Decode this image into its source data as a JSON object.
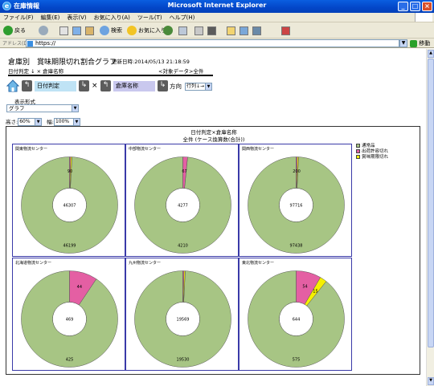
{
  "window": {
    "page_title": "在庫情報",
    "app_title": "Microsoft Internet Explorer",
    "min": "_",
    "max": "□",
    "close": "×"
  },
  "menu": [
    "ファイル(F)",
    "編集(E)",
    "表示(V)",
    "お気に入り(A)",
    "ツール(T)",
    "ヘルプ(H)"
  ],
  "toolbar": {
    "back": "戻る",
    "search": "検索",
    "favorites": "お気に入り"
  },
  "address": {
    "label": "アドレス(D)",
    "url": "https://",
    "go": "移動"
  },
  "report": {
    "title": "倉庫別　賞味期限切れ割合グラフ",
    "updated": "更新日時:2014/05/13 21:18:59",
    "condition": "日付判定 ↓ × 倉庫名称",
    "filter": "<対象データ>全件",
    "row_axis": "日付判定",
    "times": "×",
    "col_axis": "倉庫名称",
    "direction_label": "方向",
    "direction_value": "行列",
    "direction_arrow": "↓→",
    "display_label": "表示形式",
    "display_value": "グラフ",
    "height_label": "高さ",
    "height_value": "60%",
    "width_label": "幅",
    "width_value": "100%"
  },
  "colors": {
    "normal": "#a7c584",
    "expired_limit": "#e45fa3",
    "past_expiry": "#f5f000",
    "panel_border": "#3a3aa8"
  },
  "chart_data": {
    "type": "pie",
    "variant": "donut",
    "title": "日付判定×倉庫名称",
    "subtitle": "全件 (ケース換算数(合計))",
    "legend": [
      "通常品",
      "出荷許容切れ",
      "賞味期限切れ"
    ],
    "panels": [
      {
        "name": "関東物流センター",
        "total": "46307",
        "values": [
          46199,
          90,
          18
        ],
        "labels": [
          "46199",
          "90",
          ""
        ]
      },
      {
        "name": "中部物流センター",
        "total": "4277",
        "values": [
          4210,
          67,
          0
        ],
        "labels": [
          "4210",
          "67",
          ""
        ]
      },
      {
        "name": "関西物流センター",
        "total": "97716",
        "values": [
          97438,
          200,
          78
        ],
        "labels": [
          "97438",
          "200",
          ""
        ]
      },
      {
        "name": "北海道物流センター",
        "total": "469",
        "values": [
          425,
          44,
          0
        ],
        "labels": [
          "425",
          "44",
          ""
        ]
      },
      {
        "name": "九州物流センター",
        "total": "19569",
        "values": [
          19530,
          30,
          9
        ],
        "labels": [
          "19530",
          "",
          ""
        ]
      },
      {
        "name": "東北物流センター",
        "total": "644",
        "values": [
          575,
          54,
          15
        ],
        "labels": [
          "575",
          "54",
          "15"
        ]
      }
    ]
  }
}
